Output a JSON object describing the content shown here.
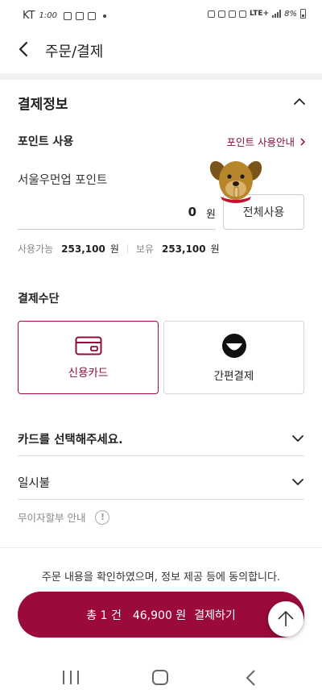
{
  "status_bar": {
    "carrier": "KT",
    "time": "1:00",
    "network": "LTE+",
    "battery": "8%"
  },
  "header": {
    "title": "주문/결제"
  },
  "payment_section": {
    "title": "결제정보",
    "points": {
      "title": "포인트 사용",
      "guide_link": "포인트 사용안내",
      "point_name": "서울우먼업 포인트",
      "input_value": "0",
      "unit": "원",
      "use_all_button": "전체사용",
      "available_label": "사용가능",
      "available_amount": "253,100",
      "available_unit": "원",
      "held_label": "보유",
      "held_amount": "253,100",
      "held_unit": "원"
    },
    "method": {
      "title": "결제수단",
      "options": [
        {
          "label": "신용카드",
          "icon": "credit-card-icon",
          "selected": true
        },
        {
          "label": "간편결제",
          "icon": "easy-pay-icon",
          "selected": false
        }
      ]
    },
    "card_select": "카드를 선택해주세요.",
    "installment_select": "일시불",
    "interest_free": "무이자할부 안내"
  },
  "footer": {
    "consent": "주문 내용을 확인하였으며, 정보 제공 등에 동의합니다.",
    "pay_count": "총 1 건",
    "pay_amount": "46,900 원",
    "pay_action": "결제하기"
  },
  "colors": {
    "accent": "#9a0a3a",
    "border": "#d6d6d6"
  }
}
